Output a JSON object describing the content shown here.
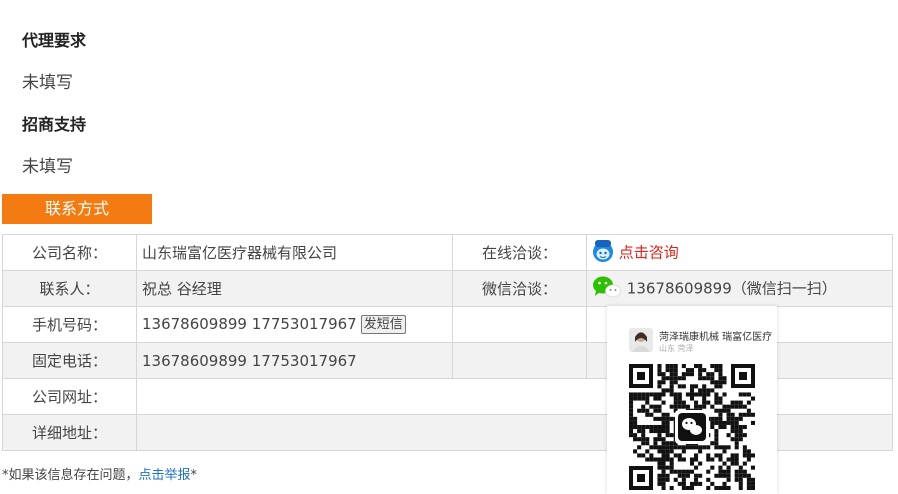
{
  "sections": {
    "agent_req": {
      "title": "代理要求",
      "value": "未填写"
    },
    "support": {
      "title": "招商支持",
      "value": "未填写"
    }
  },
  "contact": {
    "header": "联系方式",
    "company_label": "公司名称：",
    "company_value": "山东瑞富亿医疗器械有限公司",
    "online_label": "在线洽谈：",
    "online_link": "点击咨询",
    "person_label": "联系人：",
    "person_value": "祝总 谷经理",
    "wechat_label": "微信洽谈：",
    "wechat_value": "13678609899（微信扫一扫）",
    "mobile_label": "手机号码：",
    "mobile_value": "13678609899 17753017967",
    "sms_button": "发短信",
    "phone_label": "固定电话：",
    "phone_value": "13678609899 17753017967",
    "website_label": "公司网址：",
    "website_value": "",
    "address_label": "详细地址：",
    "address_value": ""
  },
  "footer": {
    "prefix": "*如果该信息存在问题，",
    "link": "点击举报",
    "suffix": "*"
  },
  "qr": {
    "name": "菏泽瑞康机械 瑞富亿医疗",
    "location": "山东 菏泽",
    "icon": "wechat-qr-icon"
  },
  "colors": {
    "accent": "#f47b11",
    "link": "#1b73c9",
    "consult": "#e2231a",
    "wechat": "#2dc100"
  }
}
